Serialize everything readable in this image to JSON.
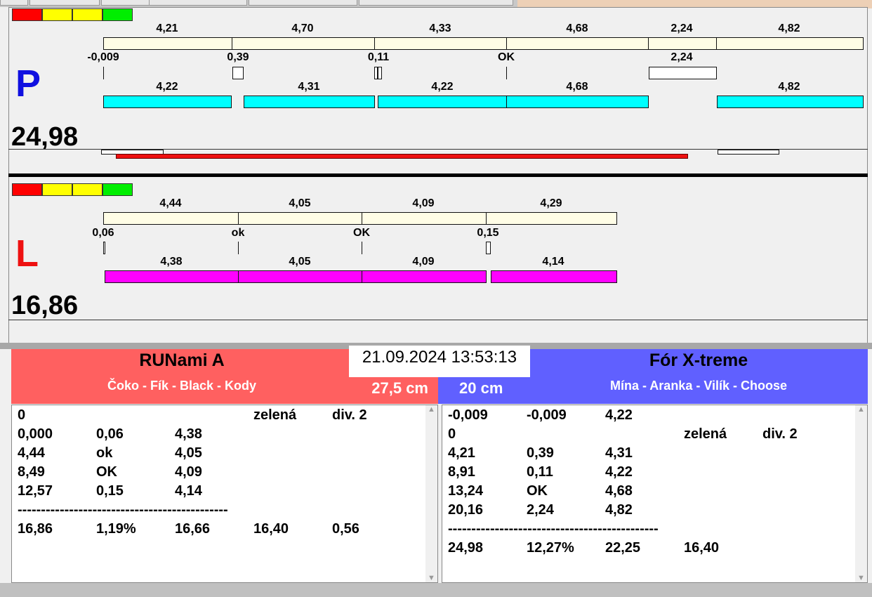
{
  "colors": {
    "red_team": "#ff6060",
    "blue_team": "#6060ff",
    "progress_red": "#ee1111"
  },
  "p": {
    "letter": "P",
    "total": "24,98",
    "top": [
      "4,21",
      "4,70",
      "4,33",
      "4,68",
      "2,24",
      "4,82"
    ],
    "mid": [
      "-0,009",
      "0,39",
      "0,11",
      "OK",
      "2,24"
    ],
    "bottom": [
      "4,22",
      "4,31",
      "4,22",
      "4,68",
      "4,82"
    ]
  },
  "l": {
    "letter": "L",
    "total": "16,86",
    "top": [
      "4,44",
      "4,05",
      "4,09",
      "4,29"
    ],
    "mid": [
      "0,06",
      "ok",
      "OK",
      "0,15"
    ],
    "bottom": [
      "4,38",
      "4,05",
      "4,09",
      "4,14"
    ]
  },
  "datetime": "21.09.2024 13:53:13",
  "left_team": {
    "name": "RUNami A",
    "dogs": "Čoko - Fík - Black - Kody",
    "height": "27,5 cm",
    "rows": [
      [
        "0",
        "",
        "",
        "zelená",
        "div. 2"
      ],
      [
        "0,000",
        "0,06",
        "4,38",
        "",
        ""
      ],
      [
        "4,44",
        "ok",
        "4,05",
        "",
        ""
      ],
      [
        "8,49",
        "OK",
        "4,09",
        "",
        ""
      ],
      [
        "12,57",
        "0,15",
        "4,14",
        "",
        ""
      ],
      [
        "---------------------------------------------",
        "",
        "",
        "",
        ""
      ],
      [
        "16,86",
        "1,19%",
        "16,66",
        "16,40",
        "0,56"
      ]
    ]
  },
  "right_team": {
    "name": "Fór X-treme",
    "dogs": "Mína - Aranka - Vilík - Choose",
    "height": "20 cm",
    "rows": [
      [
        "-0,009",
        "-0,009",
        "4,22",
        "",
        ""
      ],
      [
        "0",
        "",
        "",
        "zelená",
        "div. 2"
      ],
      [
        "4,21",
        "0,39",
        "4,31",
        "",
        ""
      ],
      [
        "8,91",
        "0,11",
        "4,22",
        "",
        ""
      ],
      [
        "13,24",
        "OK",
        "4,68",
        "",
        ""
      ],
      [
        "20,16",
        "2,24",
        "4,82",
        "",
        ""
      ],
      [
        "---------------------------------------------",
        "",
        "",
        "",
        ""
      ],
      [
        "24,98",
        "12,27%",
        "22,25",
        "16,40",
        ""
      ]
    ]
  }
}
